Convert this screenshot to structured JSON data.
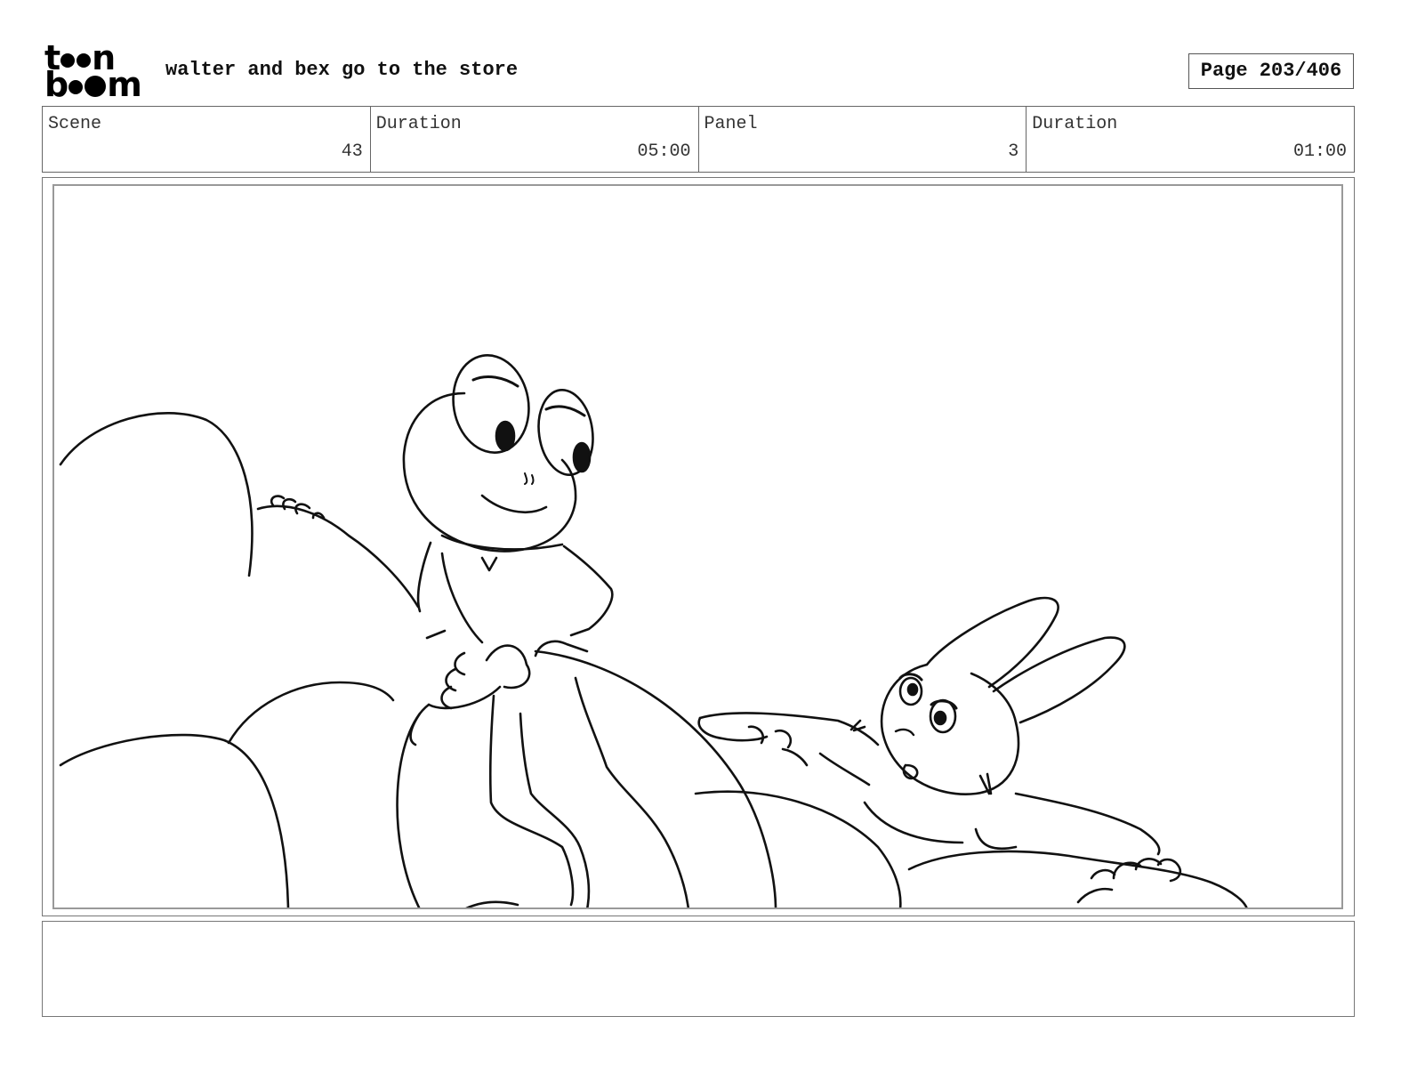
{
  "header": {
    "logo_text": "toonboom",
    "title": "walter and bex go to the store",
    "page_label": "Page 203/406"
  },
  "info": {
    "scene_label": "Scene",
    "scene_value": "43",
    "scene_duration_label": "Duration",
    "scene_duration_value": "05:00",
    "panel_label": "Panel",
    "panel_value": "3",
    "panel_duration_label": "Duration",
    "panel_duration_value": "01:00"
  },
  "notes": {
    "text": ""
  }
}
